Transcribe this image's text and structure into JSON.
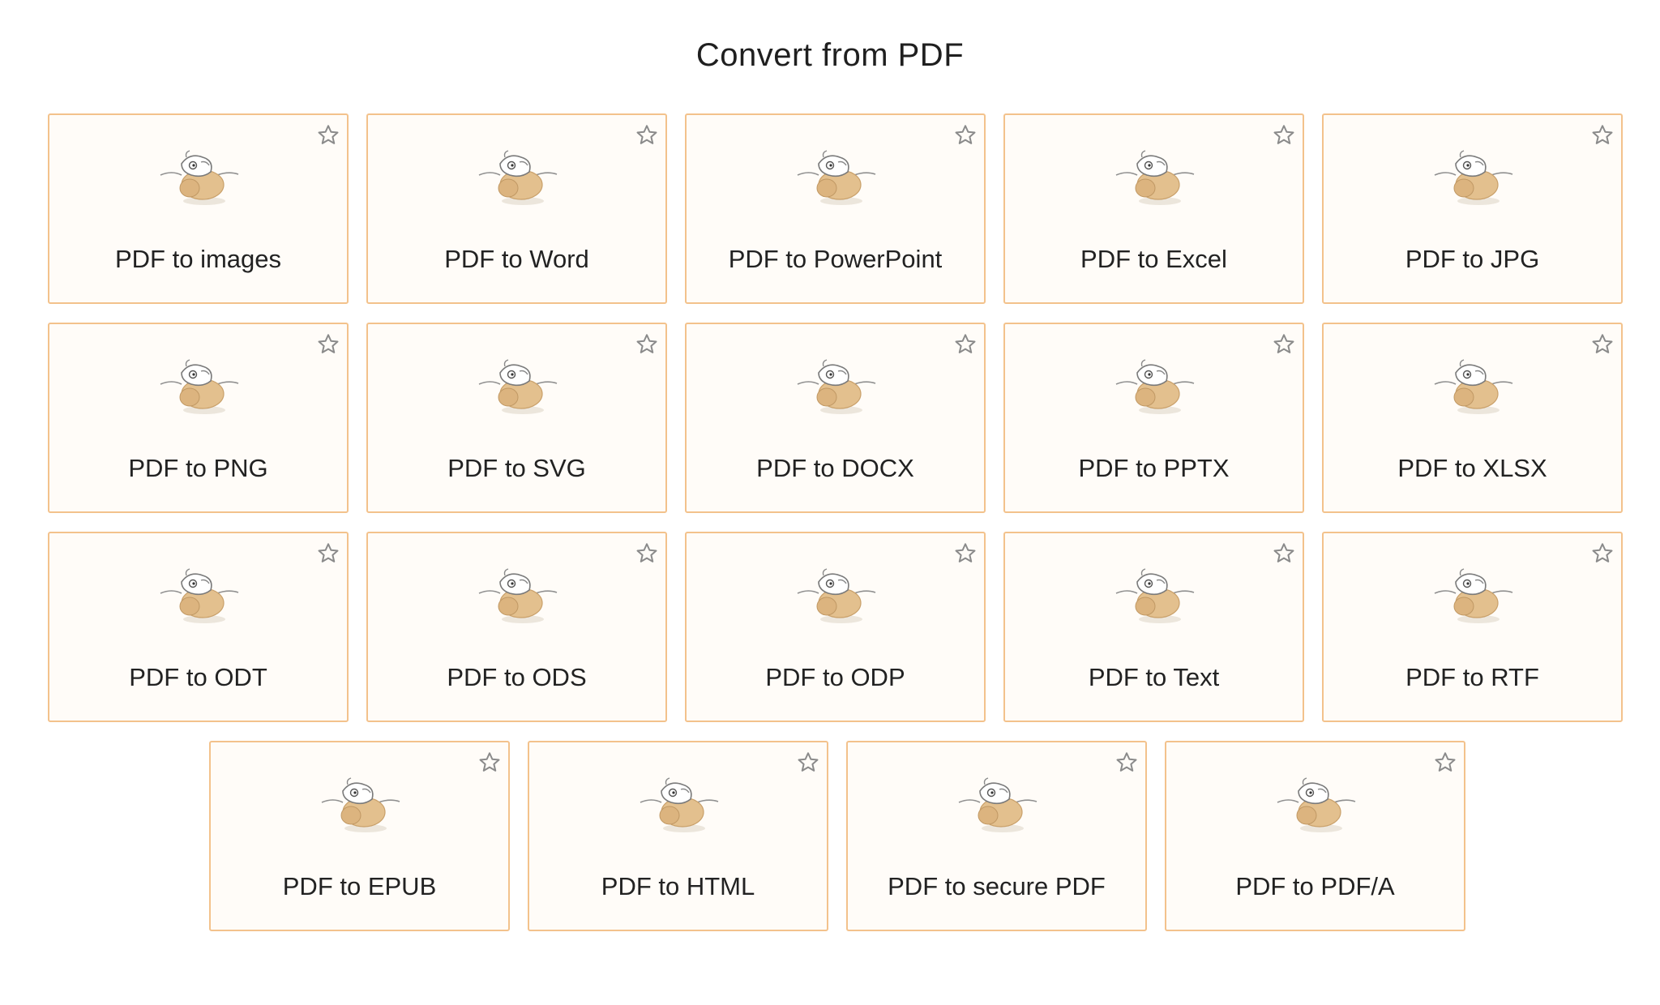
{
  "page": {
    "title": "Convert from PDF"
  },
  "colors": {
    "card_border": "#f3c28c",
    "card_background": "#fffcf8",
    "icon_body": "#e3c08e",
    "star_stroke": "#8a8a8a"
  },
  "rows": [
    {
      "items": [
        {
          "label": "PDF to images",
          "icon": "goose-mascot-icon",
          "favorite": false
        },
        {
          "label": "PDF to Word",
          "icon": "goose-mascot-icon",
          "favorite": false
        },
        {
          "label": "PDF to PowerPoint",
          "icon": "goose-mascot-icon",
          "favorite": false
        },
        {
          "label": "PDF to Excel",
          "icon": "goose-mascot-icon",
          "favorite": false
        },
        {
          "label": "PDF to JPG",
          "icon": "goose-mascot-icon",
          "favorite": false
        }
      ]
    },
    {
      "items": [
        {
          "label": "PDF to PNG",
          "icon": "goose-mascot-icon",
          "favorite": false
        },
        {
          "label": "PDF to SVG",
          "icon": "goose-mascot-icon",
          "favorite": false
        },
        {
          "label": "PDF to DOCX",
          "icon": "goose-mascot-icon",
          "favorite": false
        },
        {
          "label": "PDF to PPTX",
          "icon": "goose-mascot-icon",
          "favorite": false
        },
        {
          "label": "PDF to XLSX",
          "icon": "goose-mascot-icon",
          "favorite": false
        }
      ]
    },
    {
      "items": [
        {
          "label": "PDF to ODT",
          "icon": "goose-mascot-icon",
          "favorite": false
        },
        {
          "label": "PDF to ODS",
          "icon": "goose-mascot-icon",
          "favorite": false
        },
        {
          "label": "PDF to ODP",
          "icon": "goose-mascot-icon",
          "favorite": false
        },
        {
          "label": "PDF to Text",
          "icon": "goose-mascot-icon",
          "favorite": false
        },
        {
          "label": "PDF to RTF",
          "icon": "goose-mascot-icon",
          "favorite": false
        }
      ]
    },
    {
      "items": [
        {
          "label": "PDF to EPUB",
          "icon": "goose-mascot-icon",
          "favorite": false
        },
        {
          "label": "PDF to HTML",
          "icon": "goose-mascot-icon",
          "favorite": false
        },
        {
          "label": "PDF to secure PDF",
          "icon": "goose-mascot-icon",
          "favorite": false
        },
        {
          "label": "PDF to PDF/A",
          "icon": "goose-mascot-icon",
          "favorite": false
        }
      ]
    }
  ]
}
